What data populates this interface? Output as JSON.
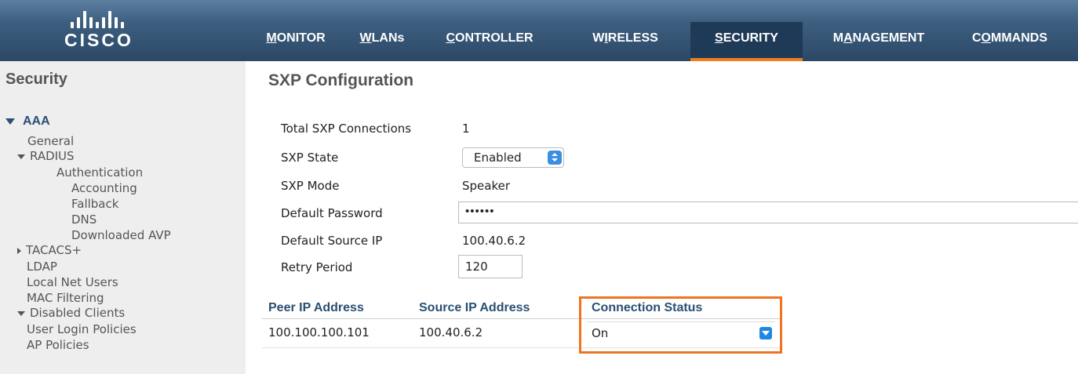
{
  "brand": {
    "name": "CISCO"
  },
  "nav": {
    "items": [
      {
        "pre": "",
        "u": "M",
        "post": "ONITOR"
      },
      {
        "pre": "",
        "u": "W",
        "post": "LANs"
      },
      {
        "pre": "",
        "u": "C",
        "post": "ONTROLLER"
      },
      {
        "pre": "W",
        "u": "I",
        "post": "RELESS"
      },
      {
        "pre": "",
        "u": "S",
        "post": "ECURITY"
      },
      {
        "pre": "M",
        "u": "A",
        "post": "NAGEMENT"
      },
      {
        "pre": "C",
        "u": "O",
        "post": "MMANDS"
      }
    ],
    "active": "SECURITY",
    "active_color": "#f07d1b"
  },
  "sidebar": {
    "title": "Security",
    "section": "AAA",
    "items": {
      "general": "General",
      "radius": "RADIUS",
      "authentication": "Authentication",
      "accounting": "Accounting",
      "fallback": "Fallback",
      "dns": "DNS",
      "downloaded_avp": "Downloaded AVP",
      "tacacs": "TACACS+",
      "ldap": "LDAP",
      "local_net_users": "Local Net Users",
      "mac_filtering": "MAC Filtering",
      "disabled_clients": "Disabled Clients",
      "user_login_policies": "User Login Policies",
      "ap_policies": "AP Policies"
    }
  },
  "main": {
    "title": "SXP Configuration",
    "fields": {
      "total_label": "Total SXP Connections",
      "total_value": "1",
      "state_label": "SXP State",
      "state_value": "Enabled",
      "mode_label": "SXP Mode",
      "mode_value": "Speaker",
      "password_label": "Default Password",
      "password_value": "••••••",
      "source_ip_label": "Default Source IP",
      "source_ip_value": "100.40.6.2",
      "retry_label": "Retry Period",
      "retry_value": "120"
    },
    "table": {
      "headers": [
        "Peer IP Address",
        "Source IP Address",
        "Connection Status"
      ],
      "rows": [
        {
          "peer_ip": "100.100.100.101",
          "source_ip": "100.40.6.2",
          "status": "On"
        }
      ]
    },
    "highlight_color": "#ee7420"
  }
}
